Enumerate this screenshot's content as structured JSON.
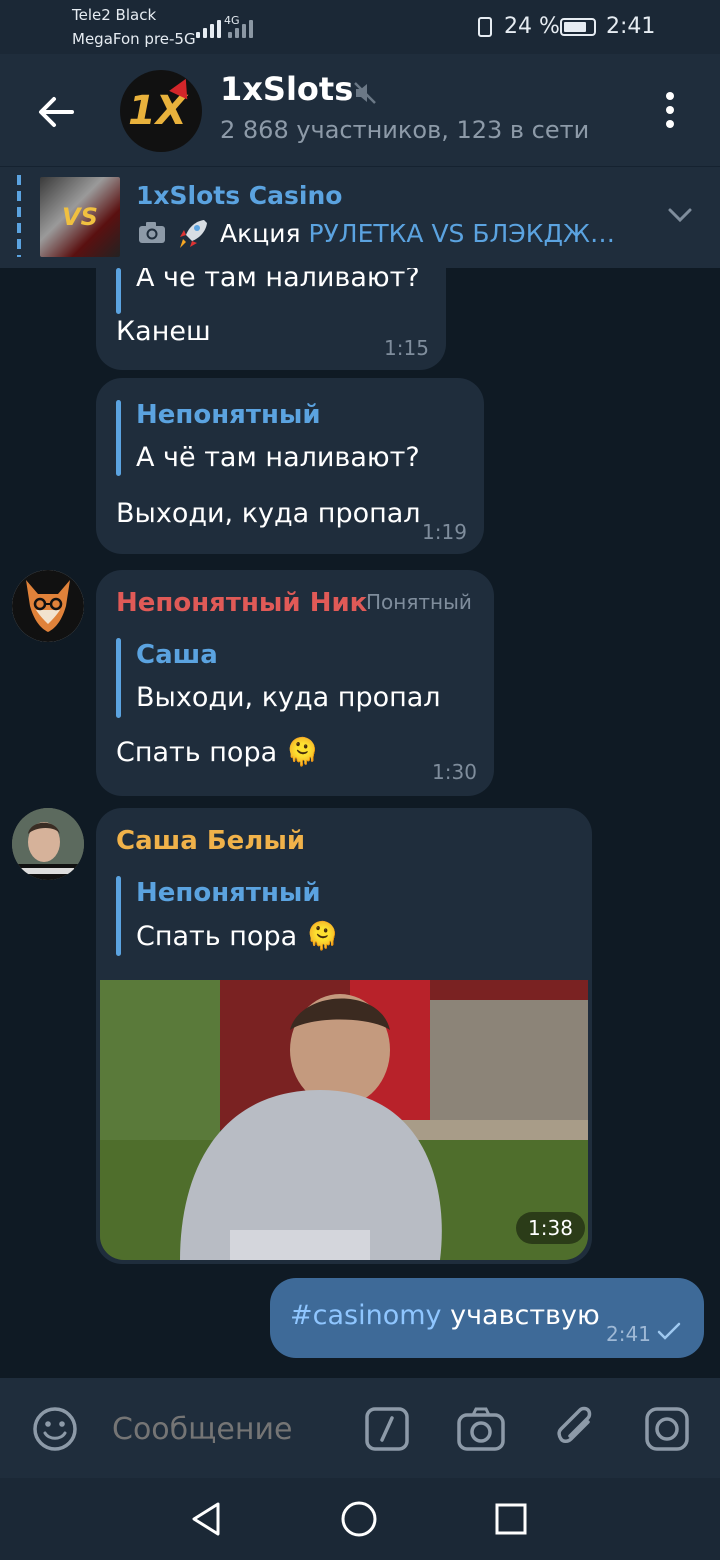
{
  "status_bar": {
    "carrier_1": "Tele2 Black",
    "carrier_2": "MegaFon pre-5G",
    "network_1": "4G",
    "battery": "24 %",
    "time": "2:41"
  },
  "header": {
    "title": "1xSlots",
    "subtitle": "2 868 участников, 123 в сети",
    "avatar_text": "1X"
  },
  "pinned": {
    "title": "1xSlots Casino",
    "prefix": "Акция",
    "link": "РУЛЕТКА VS БЛЭКДЖ…",
    "thumb_text": "VS"
  },
  "messages": [
    {
      "reply_text": "А че там наливают?",
      "text": "Канеш",
      "time": "1:15"
    },
    {
      "reply_name": "Непонятный",
      "reply_text": "А чё там наливают?",
      "text": "Выходи, куда пропал",
      "time": "1:19"
    },
    {
      "sender": "Непонятный Ник",
      "sender_tag": "Понятный",
      "reply_name": "Саша",
      "reply_text": "Выходи, куда пропал",
      "text": "Спать пора",
      "emoji": "🫠",
      "time": "1:30"
    },
    {
      "sender": "Саша Белый",
      "reply_name": "Непонятный",
      "reply_text": "Спать пора",
      "emoji": "🫠",
      "media_duration": "1:38"
    },
    {
      "hashtag": "#casinomy",
      "text": "учавствую",
      "time": "2:41"
    }
  ],
  "input": {
    "placeholder": "Сообщение"
  },
  "colors": {
    "accent": "#5ba3e0",
    "sender_red": "#e05a57",
    "sender_orange": "#f0b24a",
    "outgoing_bubble": "#3e6a98"
  }
}
